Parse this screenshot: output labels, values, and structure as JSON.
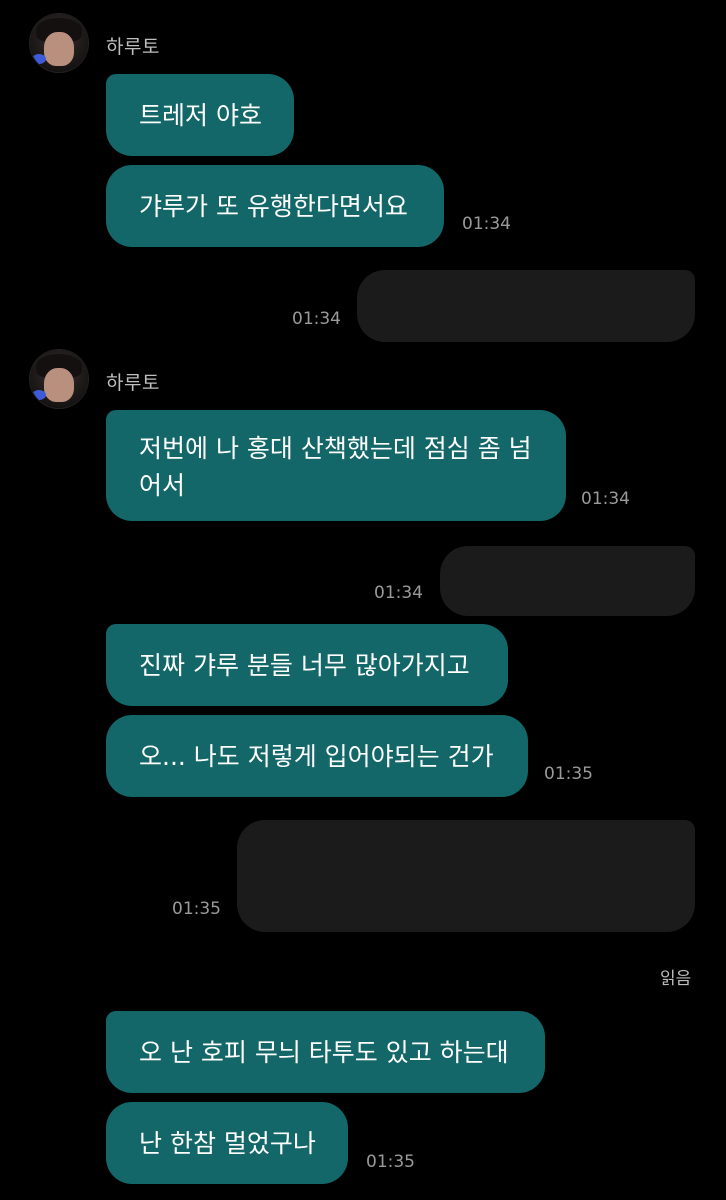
{
  "chat": {
    "sender_name": "하루토",
    "read_label": "읽음",
    "messages": [
      {
        "text": "트레저 야호"
      },
      {
        "text": "갸루가 또 유행한다면서요",
        "time": "01:34"
      },
      {
        "time": "01:34"
      },
      {
        "text": "저번에 나 홍대 산책했는데 점심 좀 넘어서",
        "time": "01:34"
      },
      {
        "time": "01:34"
      },
      {
        "text": "진짜 갸루 분들 너무 많아가지고"
      },
      {
        "text": "오... 나도 저렇게 입어야되는 건가",
        "time": "01:35"
      },
      {
        "time": "01:35"
      },
      {
        "text": "오 난 호피 무늬 타투도 있고 하는대"
      },
      {
        "text": "난 한참 멀었구나",
        "time": "01:35"
      }
    ]
  },
  "colors": {
    "background": "#000000",
    "received_bubble": "#136769",
    "sent_bubble": "#1b1b1b"
  }
}
